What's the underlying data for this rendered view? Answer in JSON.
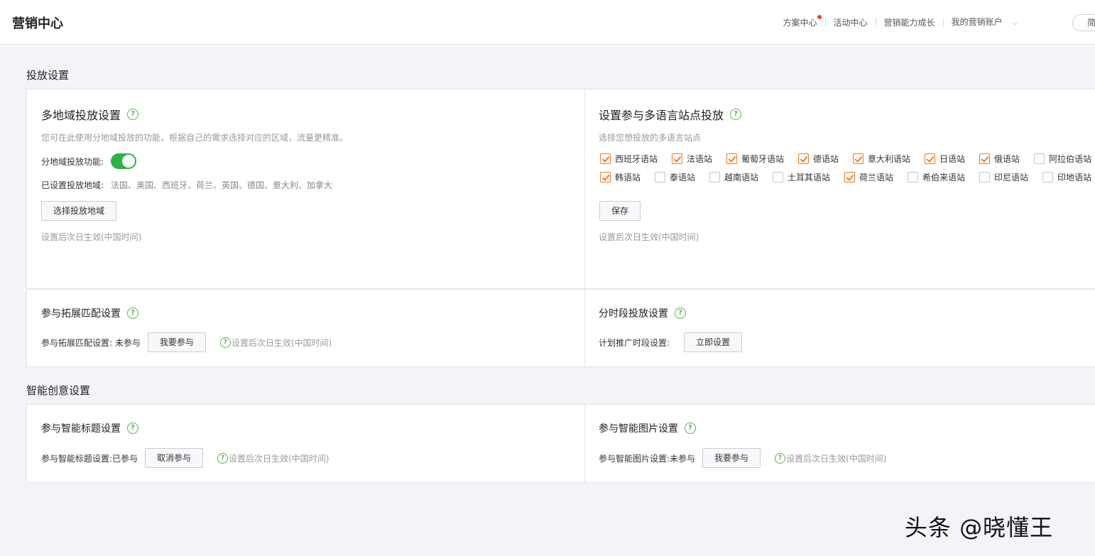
{
  "header": {
    "title": "营销中心",
    "nav": [
      {
        "label": "方案中心",
        "badge": true
      },
      {
        "label": "活动中心"
      },
      {
        "label": "营销能力成长"
      },
      {
        "label": "我的营销账户",
        "dropdown": true
      }
    ],
    "lang_button": "简"
  },
  "placement": {
    "section_title": "投放设置",
    "multi_region": {
      "title": "多地域投放设置",
      "desc": "您可在此使用分地域投放的功能，根据自己的需求选择对应的区域，流量更精准。",
      "toggle_label": "分地域投放功能:",
      "toggle_on": true,
      "regions_label": "已设置投放地域:",
      "regions_value": "法国、美国、西班牙、荷兰、英国、德国、意大利、加拿大",
      "select_button": "选择投放地域",
      "note": "设置后次日生效(中国时间)"
    },
    "multi_lang": {
      "title": "设置参与多语言站点投放",
      "desc": "选择您想投放的多语言站点",
      "sites": [
        {
          "label": "西班牙语站",
          "checked": true
        },
        {
          "label": "法语站",
          "checked": true
        },
        {
          "label": "葡萄牙语站",
          "checked": true
        },
        {
          "label": "德语站",
          "checked": true
        },
        {
          "label": "意大利语站",
          "checked": true
        },
        {
          "label": "日语站",
          "checked": true
        },
        {
          "label": "俄语站",
          "checked": true
        },
        {
          "label": "阿拉伯语站",
          "checked": false
        },
        {
          "label": "韩语站",
          "checked": true
        },
        {
          "label": "泰语站",
          "checked": false
        },
        {
          "label": "越南语站",
          "checked": false
        },
        {
          "label": "土耳其语站",
          "checked": false
        },
        {
          "label": "荷兰语站",
          "checked": true
        },
        {
          "label": "希伯来语站",
          "checked": false
        },
        {
          "label": "印尼语站",
          "checked": false
        },
        {
          "label": "印地语站",
          "checked": false
        }
      ],
      "save_button": "保存",
      "note": "设置后次日生效(中国时间)"
    },
    "expand_match": {
      "title": "参与拓展匹配设置",
      "status_label": "参与拓展匹配设置: 未参与",
      "button": "我要参与",
      "note": "设置后次日生效(中国时间)"
    },
    "time_slot": {
      "title": "分时段投放设置",
      "label": "计划推广时段设置:",
      "button": "立即设置"
    }
  },
  "creative": {
    "section_title": "智能创意设置",
    "smart_title": {
      "title": "参与智能标题设置",
      "status_label": "参与智能标题设置:已参与",
      "button": "取消参与",
      "note": "设置后次日生效(中国时间)"
    },
    "smart_image": {
      "title": "参与智能图片设置",
      "status_label": "参与智能图片设置:未参与",
      "button": "我要参与",
      "note": "设置后次日生效(中国时间)"
    }
  },
  "watermark": "头条 @晓懂王",
  "colors": {
    "accent_green": "#2eb24a",
    "check_orange": "#f07a22",
    "badge_red": "#f04134"
  }
}
